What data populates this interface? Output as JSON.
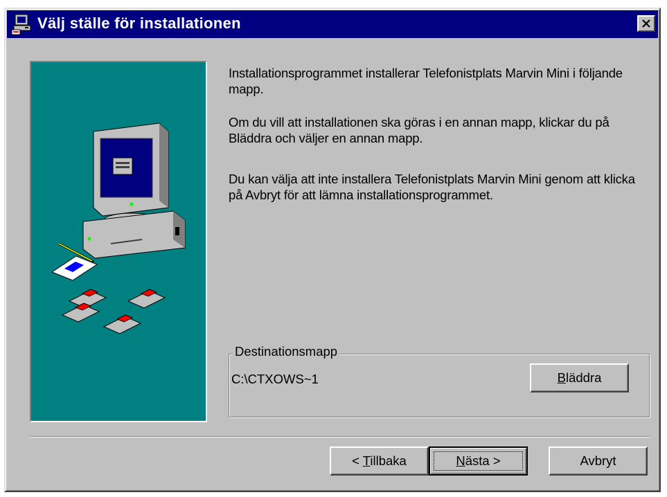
{
  "window": {
    "title": "Välj ställe för installationen",
    "close_symbol": "✕"
  },
  "icons": {
    "app": "installer-computer-icon",
    "close": "close-icon",
    "illustration": "computer-with-disks-illustration"
  },
  "content": {
    "paragraph1": "Installationsprogrammet installerar Telefonistplats Marvin Mini i följande mapp.",
    "paragraph2": "Om du vill att installationen ska göras i en annan mapp, klickar du på Bläddra och väljer en annan mapp.",
    "paragraph3": "Du kan välja att inte installera Telefonistplats Marvin Mini genom att klicka på Avbryt för att lämna installationsprogrammet."
  },
  "destination": {
    "label": "Destinationsmapp",
    "path": "C:\\CTXOWS~1",
    "browse_accel": "B",
    "browse_rest": "läddra"
  },
  "buttons": {
    "back_prefix": "< ",
    "back_accel": "T",
    "back_rest": "illbaka",
    "next_accel": "N",
    "next_rest": "ästa >",
    "cancel": "Avbryt"
  },
  "colors": {
    "titlebar": "#000080",
    "face": "#c0c0c0",
    "panel": "#008080"
  }
}
